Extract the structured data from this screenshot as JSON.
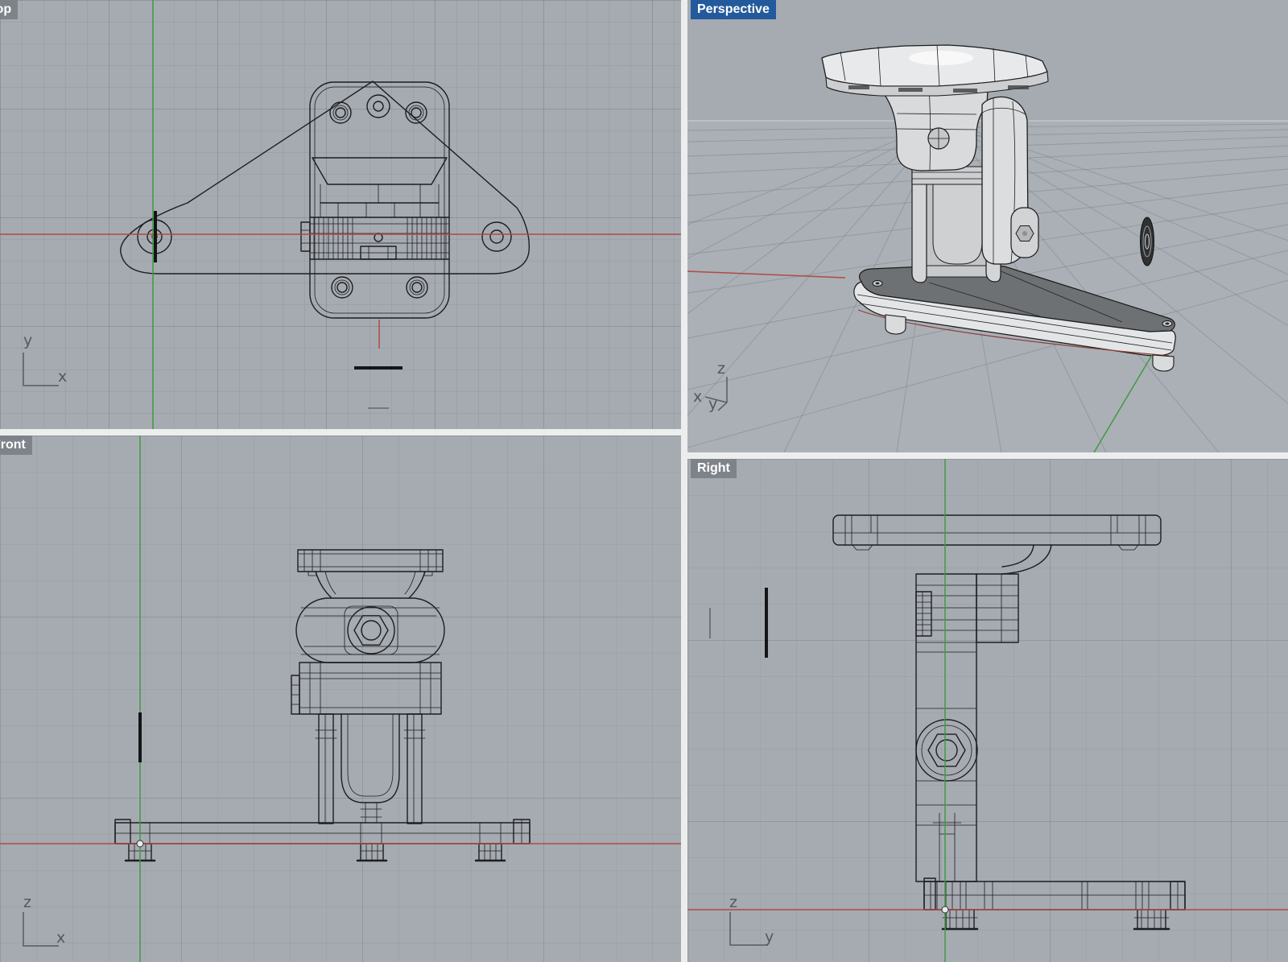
{
  "viewports": {
    "top": {
      "label": "Top",
      "active": false,
      "axis_vertical": "y",
      "axis_horizontal": "x"
    },
    "perspective": {
      "label": "Perspective",
      "active": true,
      "axis_up": "z",
      "axis_left": "x",
      "axis_right": "y"
    },
    "front": {
      "label": "Front",
      "active": false,
      "axis_vertical": "z",
      "axis_horizontal": "x"
    },
    "right": {
      "label": "Right",
      "active": false,
      "axis_vertical": "z",
      "axis_horizontal": "y"
    }
  },
  "colors": {
    "viewport_background": "#a6abb2",
    "grid_line": "#8d949c",
    "divider": "#eceded",
    "label_active_background": "#235a9c",
    "label_inactive_background": "#7e838a",
    "label_text": "#ffffff",
    "x_axis_red": "#b04a42",
    "y_axis_green": "#3f9b41",
    "model_edge": "#1c1d1f",
    "model_surface_light": "#dcdde0",
    "model_surface_shadow": "#6e7174",
    "selected_object_black": "#141517"
  }
}
